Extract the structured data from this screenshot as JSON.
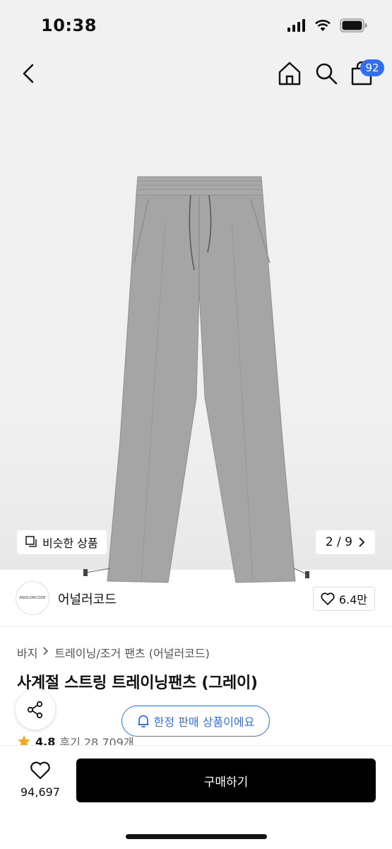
{
  "status_bar": {
    "time": "10:38"
  },
  "nav": {
    "cart_count": "92"
  },
  "gallery": {
    "similar_label": "비슷한 상품",
    "page_indicator": "2 / 9"
  },
  "brand": {
    "logo_text": "ANOLORCODE",
    "name": "어널러코드",
    "likes": "6.4만"
  },
  "breadcrumb": {
    "category": "바지",
    "subcategory": "트레이닝/조거 팬츠 (어널러코드)"
  },
  "product": {
    "title": "사계절 스트링 트레이닝팬츠 (그레이)",
    "limited_notice": "한정 판매 상품이에요",
    "rating": "4.8",
    "reviews": "후기 28,709개"
  },
  "bottom": {
    "wish_count": "94,697",
    "buy_label": "구매하기"
  },
  "colors": {
    "accent": "#2f6ef5",
    "buy_button": "#000000",
    "pants": "#a5a5a5",
    "star": "#f5a623"
  }
}
